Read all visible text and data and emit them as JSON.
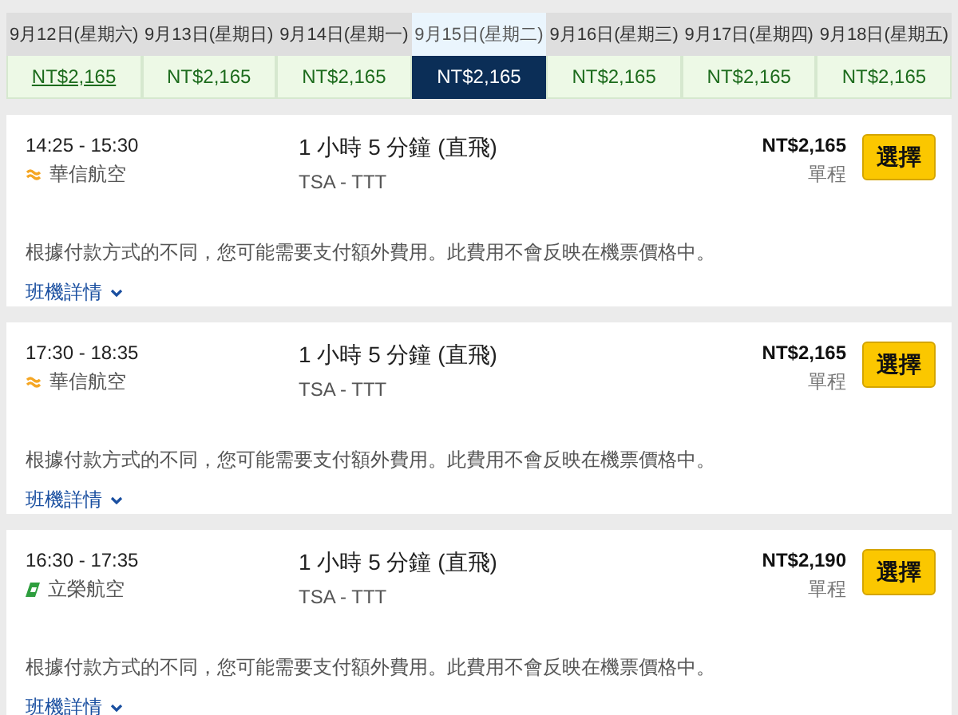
{
  "dates": [
    {
      "label": "9月12日(星期六)",
      "price": "NT$2,165",
      "selected": false,
      "hovered": true
    },
    {
      "label": "9月13日(星期日)",
      "price": "NT$2,165",
      "selected": false,
      "hovered": false
    },
    {
      "label": "9月14日(星期一)",
      "price": "NT$2,165",
      "selected": false,
      "hovered": false
    },
    {
      "label": "9月15日(星期二)",
      "price": "NT$2,165",
      "selected": true,
      "hovered": false
    },
    {
      "label": "9月16日(星期三)",
      "price": "NT$2,165",
      "selected": false,
      "hovered": false
    },
    {
      "label": "9月17日(星期四)",
      "price": "NT$2,165",
      "selected": false,
      "hovered": false
    },
    {
      "label": "9月18日(星期五)",
      "price": "NT$2,165",
      "selected": false,
      "hovered": false
    }
  ],
  "flights": [
    {
      "time": "14:25 - 15:30",
      "airline": "華信航空",
      "kind": "wave",
      "duration": "1 小時 5 分鐘 (直飛)",
      "route": "TSA - TTT",
      "price": "NT$2,165",
      "trip": "單程",
      "button": "選擇",
      "notice": "根據付款方式的不同，您可能需要支付額外費用。此費用不會反映在機票價格中。",
      "details": "班機詳情"
    },
    {
      "time": "17:30 - 18:35",
      "airline": "華信航空",
      "kind": "wave",
      "duration": "1 小時 5 分鐘 (直飛)",
      "route": "TSA - TTT",
      "price": "NT$2,165",
      "trip": "單程",
      "button": "選擇",
      "notice": "根據付款方式的不同，您可能需要支付額外費用。此費用不會反映在機票價格中。",
      "details": "班機詳情"
    },
    {
      "time": "16:30 - 17:35",
      "airline": "立榮航空",
      "kind": "wing",
      "duration": "1 小時 5 分鐘 (直飛)",
      "route": "TSA - TTT",
      "price": "NT$2,190",
      "trip": "單程",
      "button": "選擇",
      "notice": "根據付款方式的不同，您可能需要支付額外費用。此費用不會反映在機票價格中。",
      "details": "班機詳情"
    }
  ]
}
